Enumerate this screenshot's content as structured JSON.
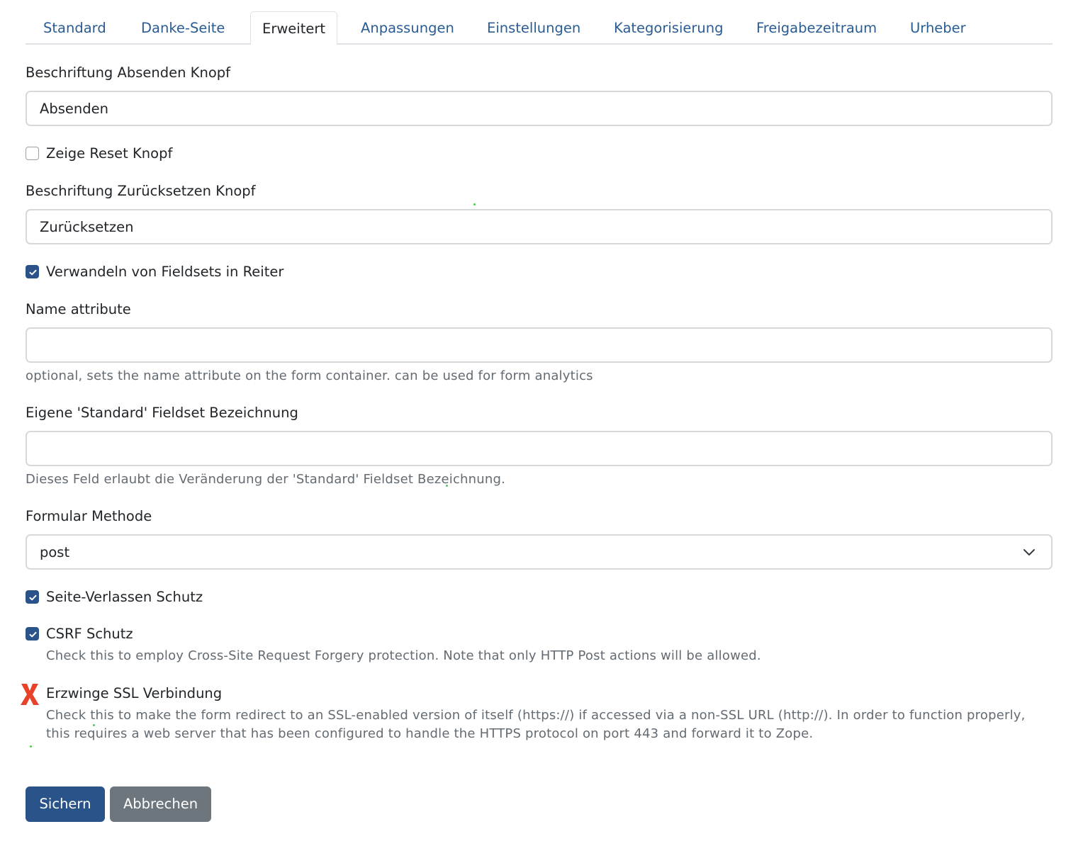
{
  "tabs": [
    {
      "label": "Standard"
    },
    {
      "label": "Danke-Seite"
    },
    {
      "label": "Erweitert",
      "active": true
    },
    {
      "label": "Anpassungen"
    },
    {
      "label": "Einstellungen"
    },
    {
      "label": "Kategorisierung"
    },
    {
      "label": "Freigabezeitraum"
    },
    {
      "label": "Urheber"
    }
  ],
  "fields": {
    "submit_label": {
      "label": "Beschriftung Absenden Knopf",
      "value": "Absenden"
    },
    "show_reset": {
      "label": "Zeige Reset Knopf",
      "checked": false
    },
    "reset_label": {
      "label": "Beschriftung Zurücksetzen Knopf",
      "value": "Zurücksetzen"
    },
    "fieldsets_tabs": {
      "label": "Verwandeln von Fieldsets in Reiter",
      "checked": true
    },
    "name_attribute": {
      "label": "Name attribute",
      "value": "",
      "help": "optional, sets the name attribute on the form container. can be used for form analytics"
    },
    "default_fieldset": {
      "label": "Eigene 'Standard' Fieldset Bezeichnung",
      "value": "",
      "help": "Dieses Feld erlaubt die Veränderung der 'Standard' Fieldset Bezeichnung."
    },
    "form_method": {
      "label": "Formular Methode",
      "value": "post"
    },
    "unload_protection": {
      "label": "Seite-Verlassen Schutz",
      "checked": true
    },
    "csrf": {
      "label": "CSRF Schutz",
      "checked": true,
      "help": "Check this to employ Cross-Site Request Forgery protection. Note that only HTTP Post actions will be allowed."
    },
    "force_ssl": {
      "label": "Erzwinge SSL Verbindung",
      "help": "Check this to make the form redirect to an SSL-enabled version of itself (https://) if accessed via a non-SSL URL (http://). In order to function properly, this requires a web server that has been configured to handle the HTTPS protocol on port 443 and forward it to Zope."
    }
  },
  "buttons": {
    "save": "Sichern",
    "cancel": "Abbrechen"
  },
  "colors": {
    "link": "#2a5c94",
    "primary": "#2a5389",
    "secondary": "#6d757d",
    "error_mark": "#e8432a"
  }
}
